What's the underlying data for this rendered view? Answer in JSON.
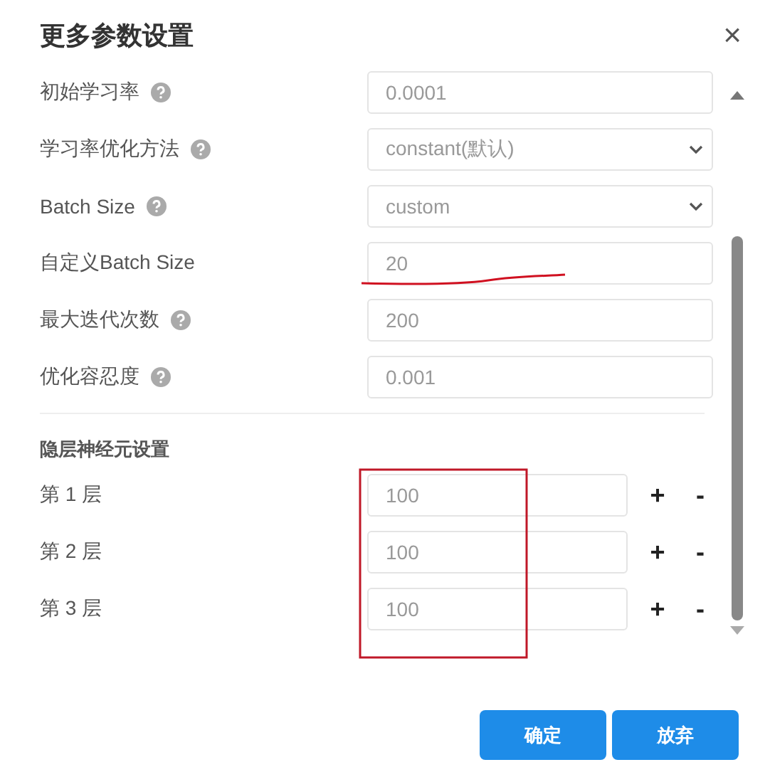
{
  "dialog": {
    "title": "更多参数设置",
    "close": "×"
  },
  "params": [
    {
      "label": "初始学习率",
      "help": true,
      "kind": "input",
      "value": "0.0001"
    },
    {
      "label": "学习率优化方法",
      "help": true,
      "kind": "select",
      "value": "constant(默认)"
    },
    {
      "label": "Batch Size",
      "help": true,
      "kind": "select",
      "value": "custom"
    },
    {
      "label": "自定义Batch Size",
      "help": false,
      "kind": "input",
      "value": "20"
    },
    {
      "label": "最大迭代次数",
      "help": true,
      "kind": "input",
      "value": "200"
    },
    {
      "label": "优化容忍度",
      "help": true,
      "kind": "input",
      "value": "0.001"
    }
  ],
  "hidden_layers": {
    "title": "隐层神经元设置",
    "layers": [
      {
        "label": "第 1 层",
        "value": "100",
        "add": "+",
        "remove": "-"
      },
      {
        "label": "第 2 层",
        "value": "100",
        "add": "+",
        "remove": "-"
      },
      {
        "label": "第 3 层",
        "value": "100",
        "add": "+",
        "remove": "-"
      }
    ]
  },
  "buttons": [
    "确定",
    "放弃"
  ]
}
